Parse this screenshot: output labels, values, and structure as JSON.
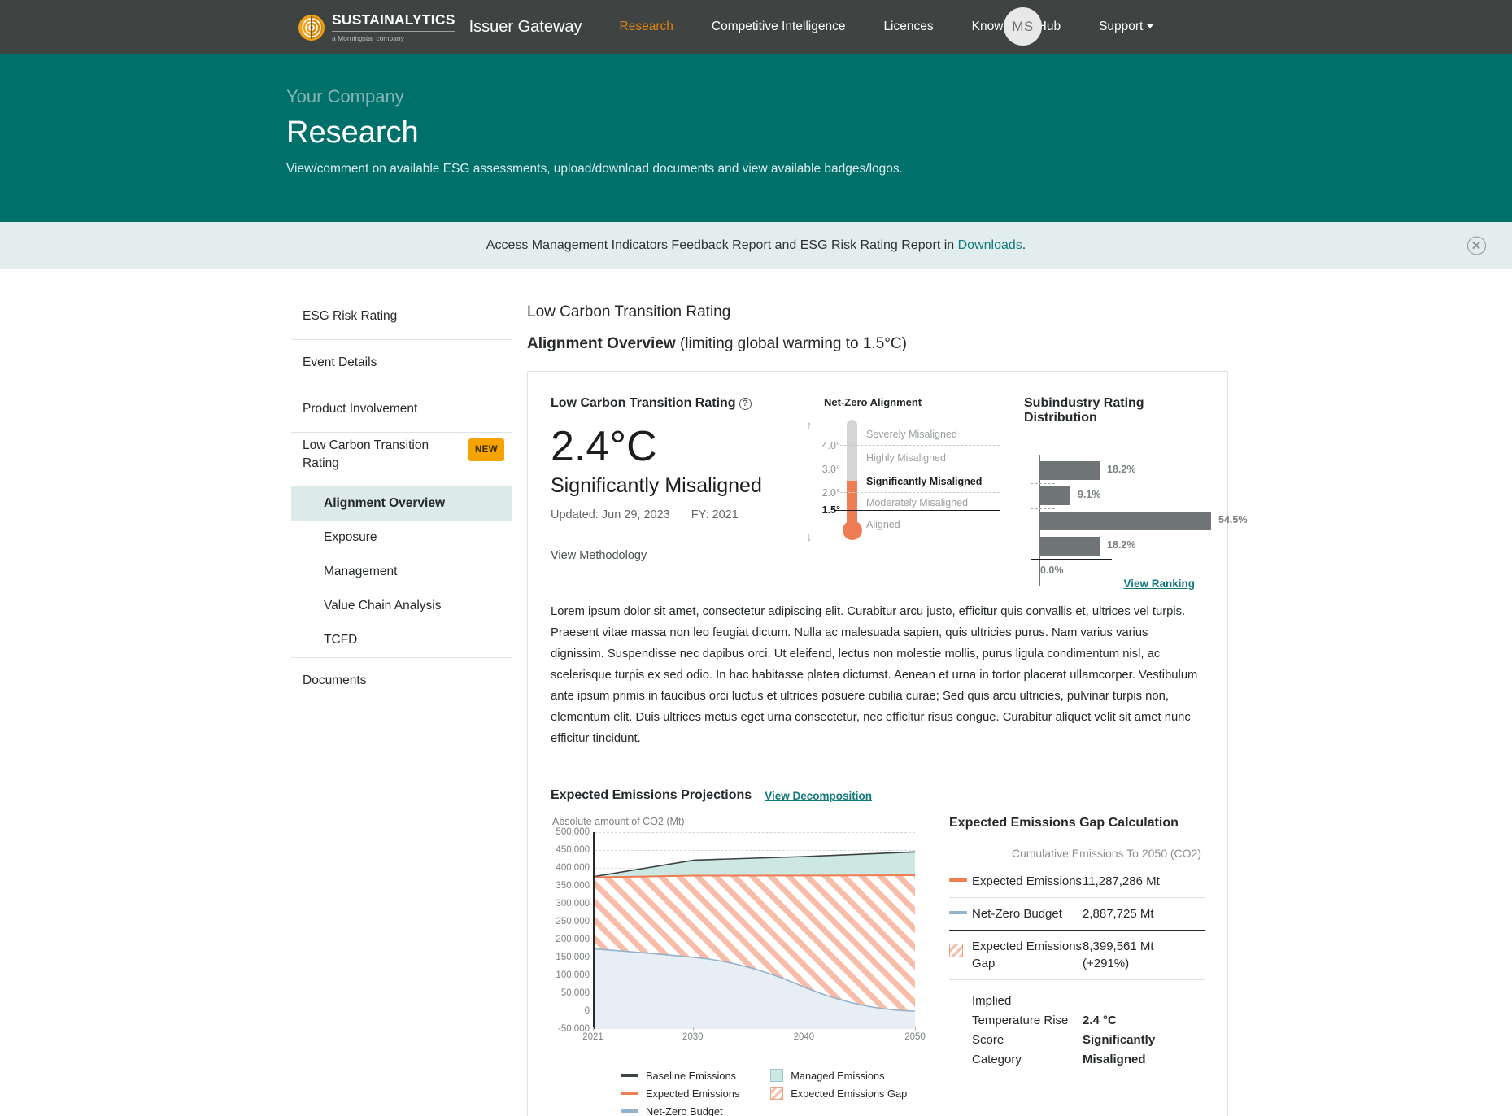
{
  "nav": {
    "logo_word": "SUSTAINALYTICS",
    "logo_sub": "a Morningstar company",
    "brand": "Issuer Gateway",
    "links": [
      {
        "label": "Research",
        "active": true
      },
      {
        "label": "Competitive Intelligence",
        "active": false
      },
      {
        "label": "Licences",
        "active": false
      },
      {
        "label": "Knowledge Hub",
        "active": false
      },
      {
        "label": "Support",
        "active": false,
        "caret": true
      }
    ],
    "avatar_initials": "MS"
  },
  "hero": {
    "eyebrow": "Your Company",
    "title": "Research",
    "subtitle": "View/comment on available ESG assessments, upload/download documents and view available badges/logos."
  },
  "banner": {
    "text_before": "Access Management Indicators Feedback Report and ESG Risk Rating Report in ",
    "link": "Downloads",
    "text_after": "."
  },
  "sidebar": {
    "items": [
      {
        "label": "ESG Risk Rating"
      },
      {
        "label": "Event Details"
      },
      {
        "label": "Product Involvement"
      },
      {
        "label": "Low Carbon Transition Rating",
        "badge": "NEW"
      },
      {
        "label": "Documents"
      }
    ],
    "sub_items": [
      {
        "label": "Alignment Overview",
        "active": true
      },
      {
        "label": "Exposure",
        "active": false
      },
      {
        "label": "Management",
        "active": false
      },
      {
        "label": "Value Chain Analysis",
        "active": false
      },
      {
        "label": "TCFD",
        "active": false
      }
    ]
  },
  "main": {
    "kicker": "Low Carbon Transition Rating",
    "heading_bold": "Alignment Overview",
    "heading_rest": " (limiting global warming to 1.5°C)",
    "paragraph": "Lorem ipsum dolor sit amet, consectetur adipiscing elit. Curabitur arcu justo, efficitur quis convallis et, ultrices vel turpis. Praesent vitae massa non leo feugiat dictum. Nulla ac malesuada sapien, quis ultricies purus. Nam varius varius dignissim. Suspendisse nec dapibus orci. Ut eleifend, lectus non molestie mollis, purus ligula condimentum nisl, ac scelerisque turpis ex sed odio. In hac habitasse platea dictumst. Aenean et urna in tortor placerat ullamcorper. Vestibulum ante ipsum primis in faucibus orci luctus et ultrices posuere cubilia curae; Sed quis arcu ultricies, pulvinar turpis non, elementum elit. Duis ultrices metus eget urna consectetur, nec efficitur risus congue. Curabitur aliquet velit sit amet nunc efficitur tincidunt."
  },
  "rating": {
    "panel_title": "Low Carbon Transition Rating",
    "help_glyph": "?",
    "temperature": "2.4°C",
    "category": "Significantly Misaligned",
    "updated": "Updated: Jun 29, 2023",
    "fiscal_year": "FY: 2021",
    "methodology_link": "View Methodology"
  },
  "thermometer": {
    "title": "Net-Zero Alignment",
    "ticks": [
      "4.0°",
      "3.0°",
      "2.0°",
      "1.5°"
    ],
    "bands": [
      {
        "label": "Severely Misaligned",
        "current": false
      },
      {
        "label": "Highly Misaligned",
        "current": false
      },
      {
        "label": "Significantly Misaligned",
        "current": true
      },
      {
        "label": "Moderately Misaligned",
        "current": false
      },
      {
        "label": "Aligned",
        "current": false
      }
    ],
    "arrow_up": "↑",
    "arrow_down": "↓",
    "mercury_color": "#ef7d54",
    "tube_color": "#d3d5d6"
  },
  "distribution": {
    "title": "Subindustry Rating Distribution",
    "view_ranking": "View Ranking",
    "bar_color": "#6f7476",
    "chart_data": {
      "type": "bar",
      "title": "Subindustry Rating Distribution",
      "orientation": "horizontal",
      "categories": [
        "Severely Misaligned",
        "Highly Misaligned",
        "Significantly Misaligned",
        "Moderately Misaligned",
        "Aligned"
      ],
      "values": [
        18.2,
        9.1,
        54.5,
        18.2,
        0.0
      ],
      "value_labels": [
        "18.2%",
        "9.1%",
        "54.5%",
        "18.2%",
        "0.0%"
      ],
      "xlabel": "",
      "ylabel": "",
      "xlim": [
        0,
        60
      ],
      "grid": false,
      "legend": "none"
    }
  },
  "projections": {
    "title": "Expected Emissions Projections",
    "view_decomposition": "View Decomposition",
    "axis_caption": "Absolute amount of CO2 (Mt)",
    "legend": [
      {
        "label": "Baseline Emissions",
        "kind": "line",
        "color": "#3d4244"
      },
      {
        "label": "Expected Emissions",
        "kind": "line",
        "color": "#ef7d54"
      },
      {
        "label": "Net-Zero Budget",
        "kind": "line",
        "color": "#93b2cc"
      },
      {
        "label": "Managed Emissions",
        "kind": "swatch",
        "color": "#cde7e2"
      },
      {
        "label": "Expected Emissions Gap",
        "kind": "hatch",
        "color": "#f7bda8"
      }
    ],
    "chart_data": {
      "type": "area",
      "title": "Expected Emissions Projections",
      "xlabel": "",
      "ylabel": "Absolute amount of CO2 (Mt)",
      "x": [
        2021,
        2030,
        2040,
        2050
      ],
      "xticks": [
        2021,
        2030,
        2040,
        2050
      ],
      "xlim": [
        2021,
        2050
      ],
      "ylim": [
        -50000,
        500000
      ],
      "yticks": [
        -50000,
        0,
        50000,
        100000,
        150000,
        200000,
        250000,
        300000,
        350000,
        400000,
        450000,
        500000
      ],
      "ytick_labels": [
        "-50,000",
        "0",
        "50,000",
        "100,000",
        "150,000",
        "200,000",
        "250,000",
        "300,000",
        "350,000",
        "400,000",
        "450,000",
        "500,000"
      ],
      "grid": true,
      "series": [
        {
          "name": "Baseline Emissions",
          "color": "#3d4244",
          "x": [
            2021,
            2030,
            2040,
            2050
          ],
          "values": [
            378000,
            455000,
            465000,
            478000
          ]
        },
        {
          "name": "Expected Emissions",
          "color": "#ef7d54",
          "x": [
            2021,
            2030,
            2040,
            2050
          ],
          "values": [
            376000,
            378000,
            378000,
            379000
          ]
        },
        {
          "name": "Net-Zero Budget",
          "color": "#93b2cc",
          "x": [
            2021,
            2030,
            2040,
            2050
          ],
          "values": [
            178000,
            152000,
            68000,
            3000
          ]
        }
      ],
      "fills": [
        {
          "name": "Managed Emissions",
          "color": "#cde7e2",
          "between": [
            "Expected Emissions",
            "Baseline Emissions"
          ]
        },
        {
          "name": "Expected Emissions Gap",
          "color": "#f7bda8",
          "hatch": true,
          "between": [
            "Net-Zero Budget",
            "Expected Emissions"
          ]
        }
      ]
    }
  },
  "gap": {
    "title": "Expected Emissions Gap Calculation",
    "column_header": "Cumulative Emissions To 2050 (CO2)",
    "rows": [
      {
        "icon": "line-orange",
        "label": "Expected Emissions",
        "value": "11,287,286 Mt"
      },
      {
        "icon": "line-blue",
        "label": "Net-Zero Budget",
        "value": "2,887,725 Mt"
      },
      {
        "icon": "hatch",
        "label": "Expected Emissions Gap",
        "value": "8,399,561 Mt",
        "value2": "(+291%)"
      }
    ],
    "implied": {
      "title": "Implied Temperature Rise",
      "score_label": "Score",
      "score_value": "2.4 °C",
      "category_label": "Category",
      "category_value_line1": "Significantly",
      "category_value_line2": "Misaligned"
    }
  }
}
